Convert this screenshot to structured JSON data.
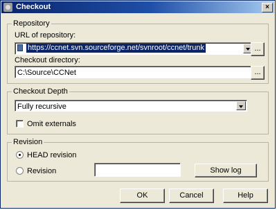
{
  "window": {
    "title": "Checkout",
    "close_glyph": "×"
  },
  "repository": {
    "legend": "Repository",
    "url_label": "URL of repository:",
    "url_value": "https://ccnet.svn.sourceforge.net/svnroot/ccnet/trunk",
    "browse_label": "...",
    "checkout_dir_label": "Checkout directory:",
    "checkout_dir_value": "C:\\Source\\CCNet",
    "dir_browse_label": "..."
  },
  "depth": {
    "legend": "Checkout Depth",
    "selected": "Fully recursive",
    "omit_externals_label": "Omit externals"
  },
  "revision": {
    "legend": "Revision",
    "head_label": "HEAD revision",
    "revision_label": "Revision",
    "revision_value": "",
    "show_log_label": "Show log"
  },
  "buttons": {
    "ok": "OK",
    "cancel": "Cancel",
    "help": "Help"
  }
}
